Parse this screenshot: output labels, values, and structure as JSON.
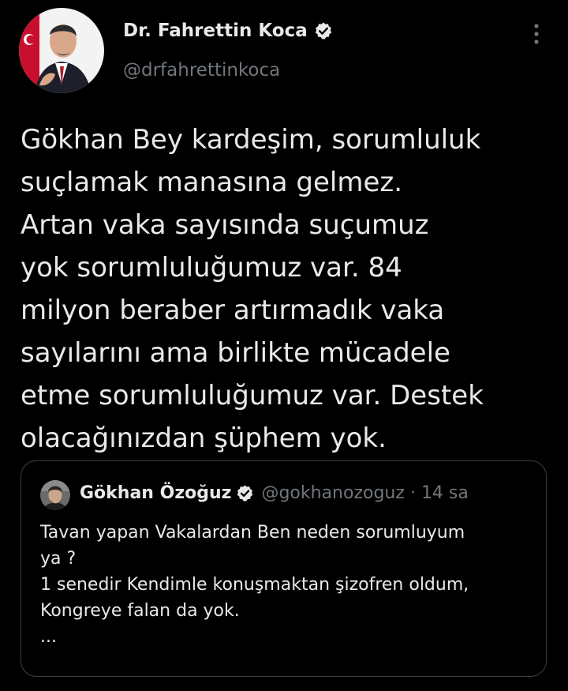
{
  "tweet": {
    "author": {
      "display_name": "Dr. Fahrettin Koca",
      "handle": "@drfahrettinkoca",
      "verified": true
    },
    "text": "Gökhan Bey kardeşim, sorumluluk\nsuçlamak manasına gelmez.\nArtan vaka sayısında suçumuz\nyok sorumluluğumuz var. 84\nmilyon beraber artırmadık vaka\nsayılarını ama birlikte mücadele\netme sorumluluğumuz var. Destek\nolacağınızdan şüphem yok.",
    "more_icon": "more-vertical-icon"
  },
  "quoted_tweet": {
    "author": {
      "display_name": "Gökhan Özoğuz",
      "handle": "@gokhanozoguz",
      "verified": true
    },
    "separator": "·",
    "time_ago": "14 sa",
    "text": "Tavan yapan Vakalardan Ben neden sorumluyum\nya ?\n1 senedir Kendimle konuşmaktan şizofren oldum,\nKongreye falan da yok.\n..."
  },
  "colors": {
    "background": "#000000",
    "primary_text": "#e7e9ea",
    "secondary_text": "#71767b",
    "border": "#3b4046",
    "verified_badge": "#e7e9ea"
  }
}
